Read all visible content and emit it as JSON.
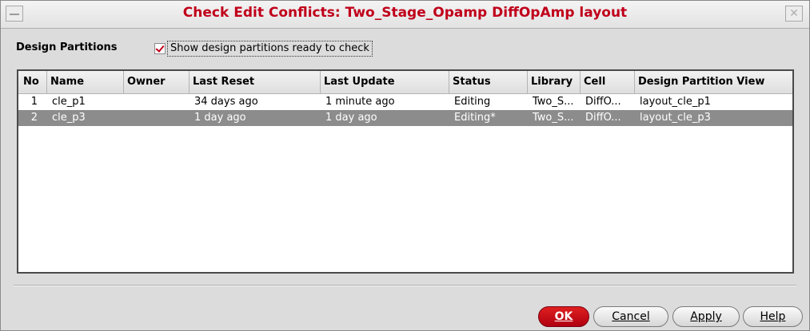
{
  "window": {
    "title": "Check Edit Conflicts: Two_Stage_Opamp DiffOpAmp layout",
    "close_glyph": "✕"
  },
  "toolbar": {
    "partitions_label": "Design Partitions",
    "show_ready_label": "Show design partitions ready to check",
    "show_ready_checked": true
  },
  "table": {
    "columns": [
      "No",
      "Name",
      "Owner",
      "Last Reset",
      "Last Update",
      "Status",
      "Library",
      "Cell",
      "Design Partition View"
    ],
    "rows": [
      {
        "no": "1",
        "name": "cle_p1",
        "owner": "",
        "last_reset": "34 days ago",
        "last_update": "1 minute ago",
        "status": "Editing",
        "library": "Two_S...",
        "cell": "DiffO...",
        "view": "layout_cle_p1"
      },
      {
        "no": "2",
        "name": "cle_p3",
        "owner": "",
        "last_reset": "1 day ago",
        "last_update": "1 day ago",
        "status": "Editing*",
        "library": "Two_S...",
        "cell": "DiffO...",
        "view": "layout_cle_p3"
      }
    ],
    "selected_row": 1
  },
  "buttons": {
    "ok": "OK",
    "cancel": "Cancel",
    "apply": "Apply",
    "help": "Help"
  },
  "colors": {
    "title": "#c0001a",
    "selected_row": "#8c8c8c",
    "ok_button": "#c8001a"
  }
}
